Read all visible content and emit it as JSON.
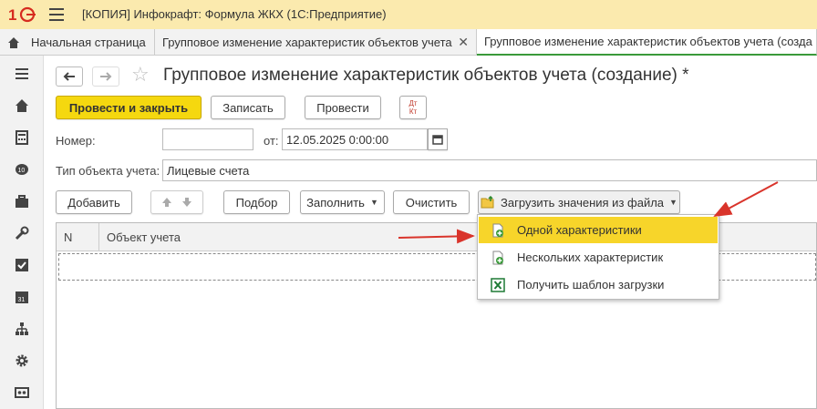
{
  "app": {
    "title": "[КОПИЯ] Инфокрафт: Формула ЖКХ  (1С:Предприятие)",
    "logo_text": "1С"
  },
  "tabs": [
    {
      "label": "Начальная страница"
    },
    {
      "label": "Групповое изменение характеристик объектов учета"
    },
    {
      "label": "Групповое изменение характеристик объектов учета (созда"
    }
  ],
  "document": {
    "title": "Групповое изменение характеристик объектов учета (создание) *"
  },
  "toolbar": {
    "post_close": "Провести и закрыть",
    "save": "Записать",
    "post": "Провести",
    "dtkt_top": "Дт",
    "dtkt_bottom": "Кт"
  },
  "form": {
    "number_label": "Номер:",
    "number_value": "",
    "date_label": "от:",
    "date_value": "12.05.2025  0:00:00",
    "object_type_label": "Тип объекта учета:",
    "object_type_value": "Лицевые счета"
  },
  "table_toolbar": {
    "add": "Добавить",
    "pick": "Подбор",
    "fill": "Заполнить",
    "clear": "Очистить",
    "load": "Загрузить значения из файла"
  },
  "table": {
    "columns": [
      "N",
      "Объект учета"
    ]
  },
  "dropdown": {
    "items": [
      {
        "label": "Одной характеристики",
        "icon": "sheet-plus-icon",
        "active": true
      },
      {
        "label": "Нескольких характеристик",
        "icon": "sheet-plus-icon",
        "active": false
      },
      {
        "label": "Получить шаблон загрузки",
        "icon": "excel-icon",
        "active": false
      }
    ]
  },
  "colors": {
    "titlebar": "#fbeaae",
    "primary_button": "#f5d80f",
    "dropdown_active": "#f7d52a",
    "annotation_arrow": "#d9342b"
  }
}
